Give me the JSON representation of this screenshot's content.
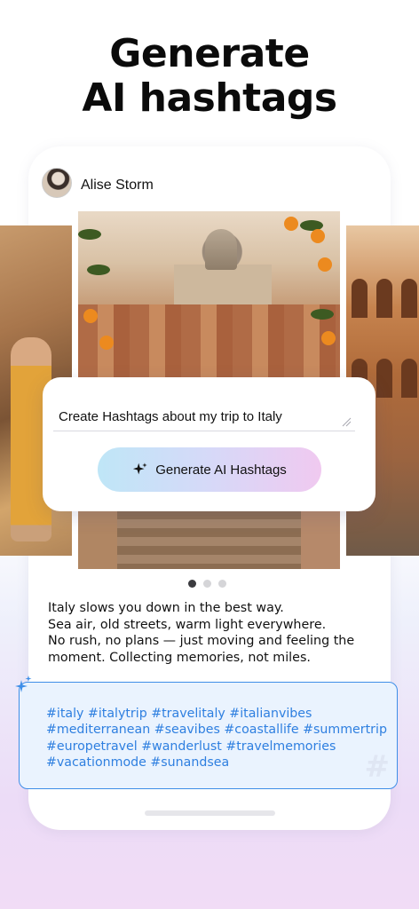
{
  "headline": {
    "line1": "Generate",
    "line2": "AI hashtags"
  },
  "post": {
    "username": "Alise Storm",
    "carousel_dots": 3,
    "active_dot": 0,
    "caption_lines": [
      "Italy slows you down in the best way.",
      "Sea air, old streets, warm light everywhere.",
      "No rush, no plans — just moving and feeling the",
      "moment. Collecting memories, not miles."
    ]
  },
  "prompt": {
    "text": "Create Hashtags about my trip to Italy",
    "button_label": "Generate AI Hashtags"
  },
  "hashtags": {
    "lines": [
      "#italy #italytrip #travelitaly #italianvibes",
      "#mediterranean #seavibes #coastallife #summertrip",
      "#europetravel #wanderlust #travelmemories",
      "#vacationmode #sunandsea"
    ],
    "watermark": "#"
  },
  "colors": {
    "accent_blue": "#2e7fe0",
    "button_gradient_start": "#bfe6f7",
    "button_gradient_end": "#f0c9f0"
  }
}
